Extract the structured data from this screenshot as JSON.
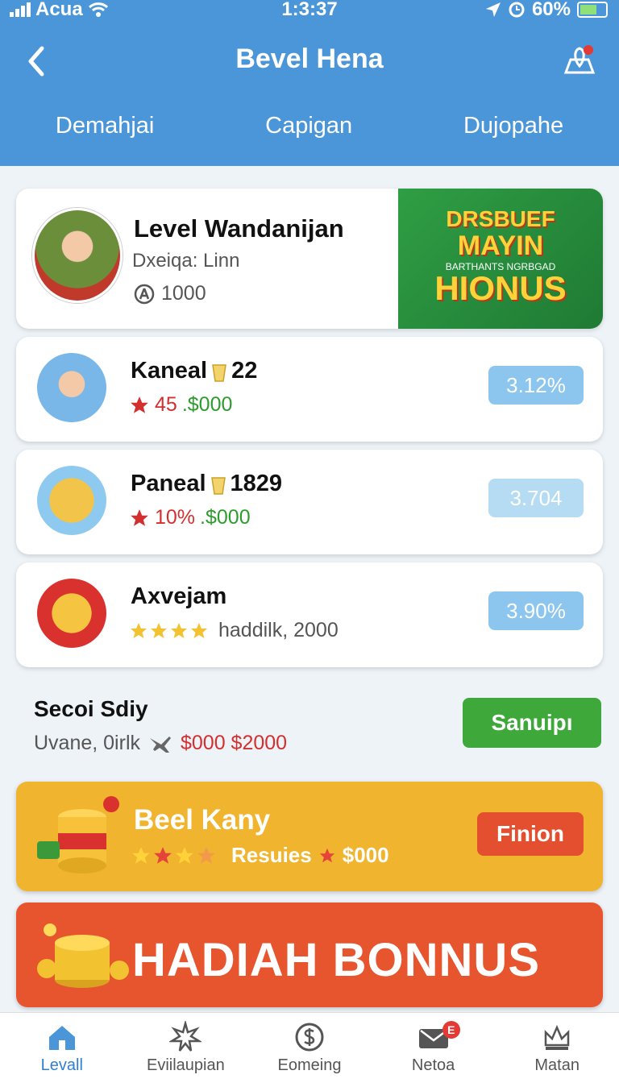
{
  "status": {
    "carrier": "Acua",
    "time": "1:3:37",
    "battery": "60%"
  },
  "header": {
    "title": "Bevel Hena"
  },
  "tabs": [
    "Demahjai",
    "Capigan",
    "Dujopahe"
  ],
  "profile": {
    "name": "Level Wandanijan",
    "subtitle": "Dxeiqa: Linn",
    "coins": "1000",
    "banner": {
      "line1": "DRSBUEF",
      "line2": "MAYIN",
      "small": "BARTHANTS NGRBGAD",
      "line3": "HIONUS"
    }
  },
  "rows": [
    {
      "name": "Kaneal",
      "level": "22",
      "sub_left": "45",
      "sub_right": ".$000",
      "pill": "3.12%"
    },
    {
      "name": "Paneal",
      "level": "1829",
      "sub_left": "10%",
      "sub_right": ".$000",
      "pill": "3.704"
    },
    {
      "name": "Axvejam",
      "sub_text": "haddilk, 2000",
      "rating": 4,
      "pill": "3.90%"
    }
  ],
  "search": {
    "title": "Secoi Sdiy",
    "subtitle": "Uvane, 0irlk",
    "price": "$000 $2000",
    "button": "Sanuipı"
  },
  "promo": {
    "title": "Beel Kany",
    "label": "Resuies",
    "value": "$000",
    "button": "Finion",
    "rating": 3
  },
  "bonus": {
    "title": "HADIAH BONNUS"
  },
  "nav": [
    {
      "label": "Levall",
      "icon": "home-icon",
      "active": true
    },
    {
      "label": "Eviilaupian",
      "icon": "star-burst-icon"
    },
    {
      "label": "Eomeing",
      "icon": "dollar-circle-icon"
    },
    {
      "label": "Netoa",
      "icon": "mail-icon",
      "badge": "E"
    },
    {
      "label": "Matan",
      "icon": "crown-icon"
    }
  ],
  "colors": {
    "header": "#4a96d8",
    "green_button": "#3ea83a",
    "promo": "#f0b42e",
    "bonus": "#e6552d",
    "pill": "#8cc6ee"
  }
}
